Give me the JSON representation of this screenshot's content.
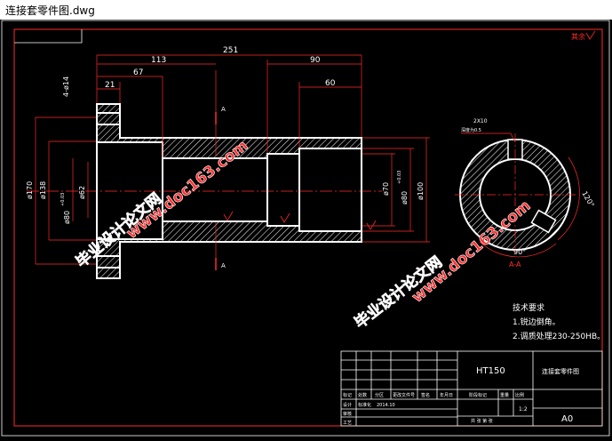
{
  "window": {
    "title": "连接套零件图.dwg"
  },
  "corner_mark": "其余",
  "dims": {
    "d251": "251",
    "d113": "113",
    "d90": "90",
    "d67": "67",
    "d60": "60",
    "d21": "21",
    "d4phi14": "4-ø14",
    "phi170": "ø170",
    "phi138": "ø138",
    "phi80a": "ø80",
    "tol_a": "+0.03",
    "phi62": "ø62",
    "phi70": "ø70",
    "phi80b": "ø80",
    "tol_b": "+0.03",
    "phi100": "ø100",
    "section_mark_a": "A",
    "angle_90": "90°",
    "angle_120": "120°",
    "section_label": "A-A",
    "keyway_note1": "2X10",
    "keyway_note2": "深度为0.5"
  },
  "watermarks": {
    "site": "www.doc163.com",
    "cn": "毕业设计论文网"
  },
  "tech_req": {
    "heading": "技术要求",
    "line1": "1.锐边倒角。",
    "line2": "2.调质处理230-250HB。"
  },
  "title_block": {
    "material": "HT150",
    "part_name": "连接套零件图",
    "scale": "1:2",
    "sheet": "A0",
    "h1": "标记",
    "h2": "处数",
    "h3": "分区",
    "h4": "更改文件号",
    "h5": "签名",
    "h6": "年月日",
    "r1": "设计",
    "r1b": "标准化",
    "r1d": "2014.10",
    "r2": "审核",
    "r3": "工艺",
    "stage": "阶段标记",
    "weight": "重量",
    "ratio": "比例",
    "sheets": "共 张 第 张"
  }
}
